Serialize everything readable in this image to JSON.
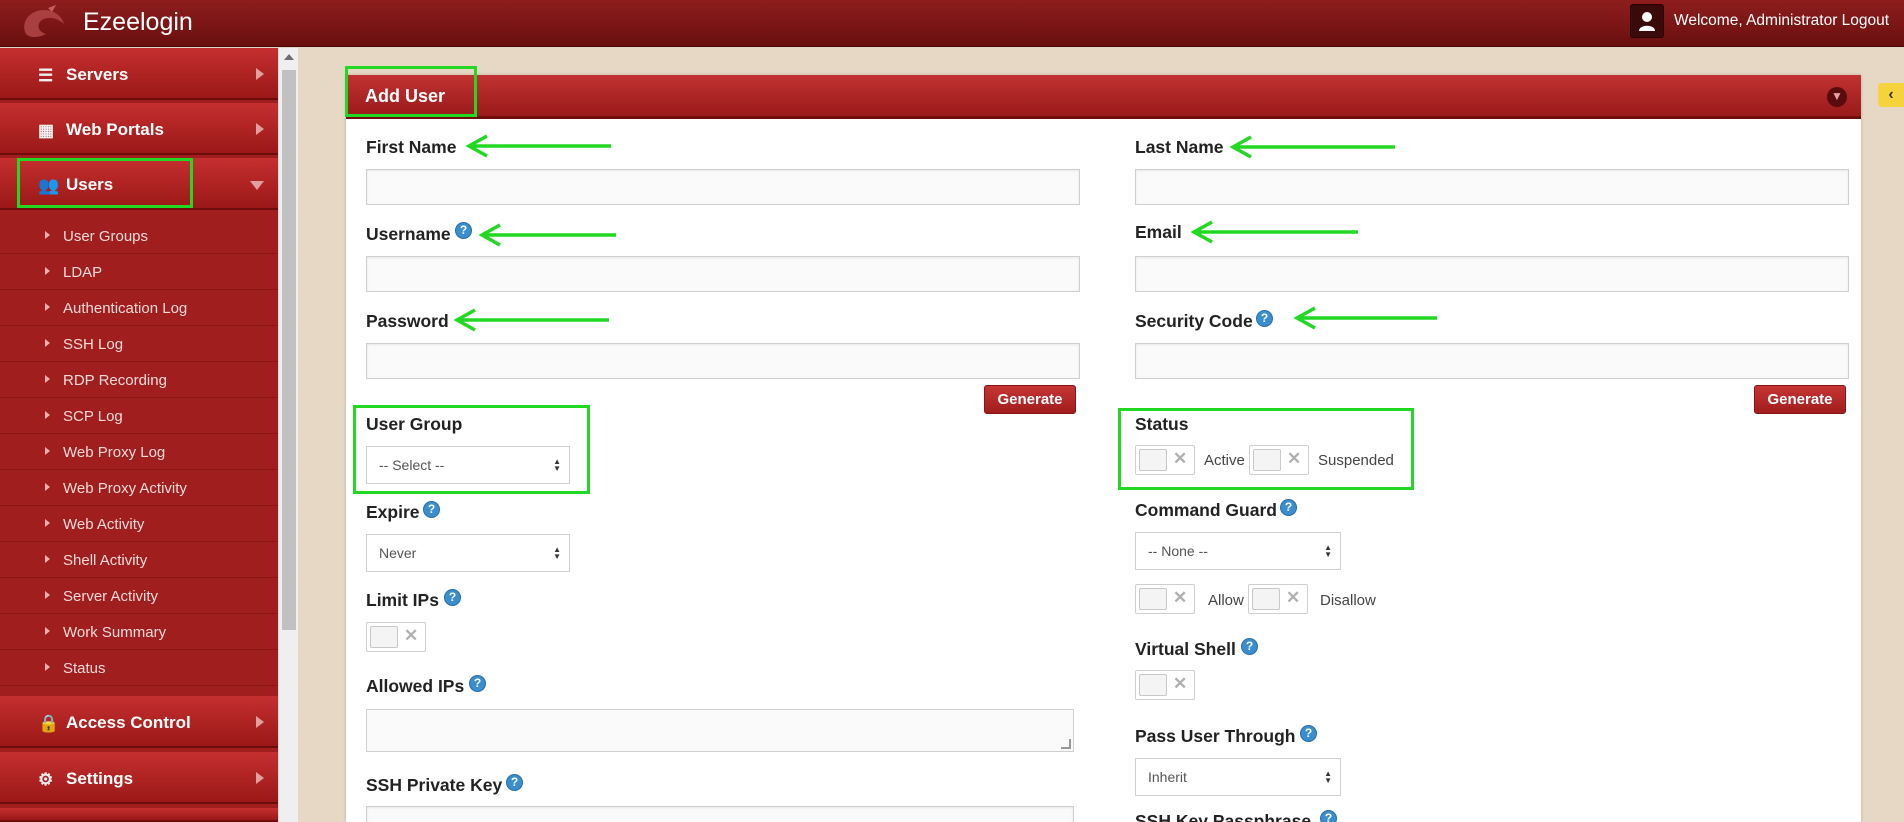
{
  "app": {
    "brand": "Ezeelogin",
    "welcome": "Welcome, Administrator Logout"
  },
  "sidebar": {
    "menus": [
      {
        "label": "Servers",
        "icon": "list-icon"
      },
      {
        "label": "Web Portals",
        "icon": "dashboard-icon"
      },
      {
        "label": "Users",
        "icon": "users-icon",
        "expanded": true
      },
      {
        "label": "Access Control",
        "icon": "lock-icon"
      },
      {
        "label": "Settings",
        "icon": "gears-icon"
      }
    ],
    "user_submenu": [
      "User Groups",
      "LDAP",
      "Authentication Log",
      "SSH Log",
      "RDP Recording",
      "SCP Log",
      "Web Proxy Log",
      "Web Proxy Activity",
      "Web Activity",
      "Shell Activity",
      "Server Activity",
      "Work Summary",
      "Status"
    ]
  },
  "form": {
    "title": "Add User",
    "first_name": "First Name",
    "last_name": "Last Name",
    "username": "Username",
    "email": "Email",
    "password": "Password",
    "security_code": "Security Code",
    "generate": "Generate",
    "user_group": "User Group",
    "user_group_value": "-- Select --",
    "status": "Status",
    "active": "Active",
    "suspended": "Suspended",
    "expire": "Expire",
    "expire_value": "Never",
    "command_guard": "Command Guard",
    "command_guard_value": "-- None --",
    "allow": "Allow",
    "disallow": "Disallow",
    "limit_ips": "Limit IPs",
    "virtual_shell": "Virtual Shell",
    "allowed_ips": "Allowed IPs",
    "pass_user_through": "Pass User Through",
    "pass_user_through_value": "Inherit",
    "ssh_private_key": "SSH Private Key",
    "ssh_key_passphrase": "SSH Key Passphrase"
  },
  "colors": {
    "brand_red": "#a11e1e",
    "highlight_green": "#22d822",
    "help_blue": "#3a8ed0"
  }
}
